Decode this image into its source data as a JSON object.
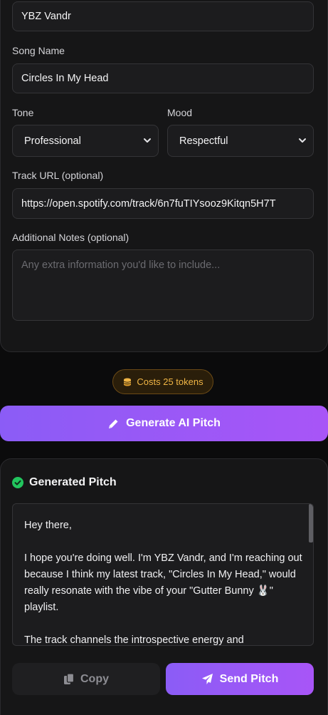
{
  "form": {
    "artist_value": "YBZ Vandr",
    "song_label": "Song Name",
    "song_value": "Circles In My Head",
    "tone_label": "Tone",
    "tone_value": "Professional",
    "mood_label": "Mood",
    "mood_value": "Respectful",
    "track_url_label": "Track URL (optional)",
    "track_url_value": "https://open.spotify.com/track/6n7fuTIYsooz9Kitqn5H7T",
    "notes_label": "Additional Notes (optional)",
    "notes_placeholder": "Any extra information you'd like to include..."
  },
  "cost": {
    "label": "Costs 25 tokens",
    "icon": "coins-icon"
  },
  "generate_button": {
    "label": "Generate AI Pitch",
    "icon": "pencil-icon"
  },
  "pitch": {
    "title": "Generated Pitch",
    "icon": "check-circle-icon",
    "paragraphs": [
      "Hey there,",
      "I hope you're doing well. I'm YBZ Vandr, and I'm reaching out because I think my latest track, \"Circles In My Head,\" would really resonate with the vibe of your \"Gutter Bunny 🐰\" playlist.",
      "The track channels the introspective energy and"
    ]
  },
  "actions": {
    "copy_label": "Copy",
    "copy_icon": "copy-icon",
    "send_label": "Send Pitch",
    "send_icon": "paper-plane-icon"
  },
  "colors": {
    "accent_start": "#8b5cf6",
    "accent_end": "#a855f7",
    "success": "#22c55e",
    "token_gold": "#f0b545"
  }
}
